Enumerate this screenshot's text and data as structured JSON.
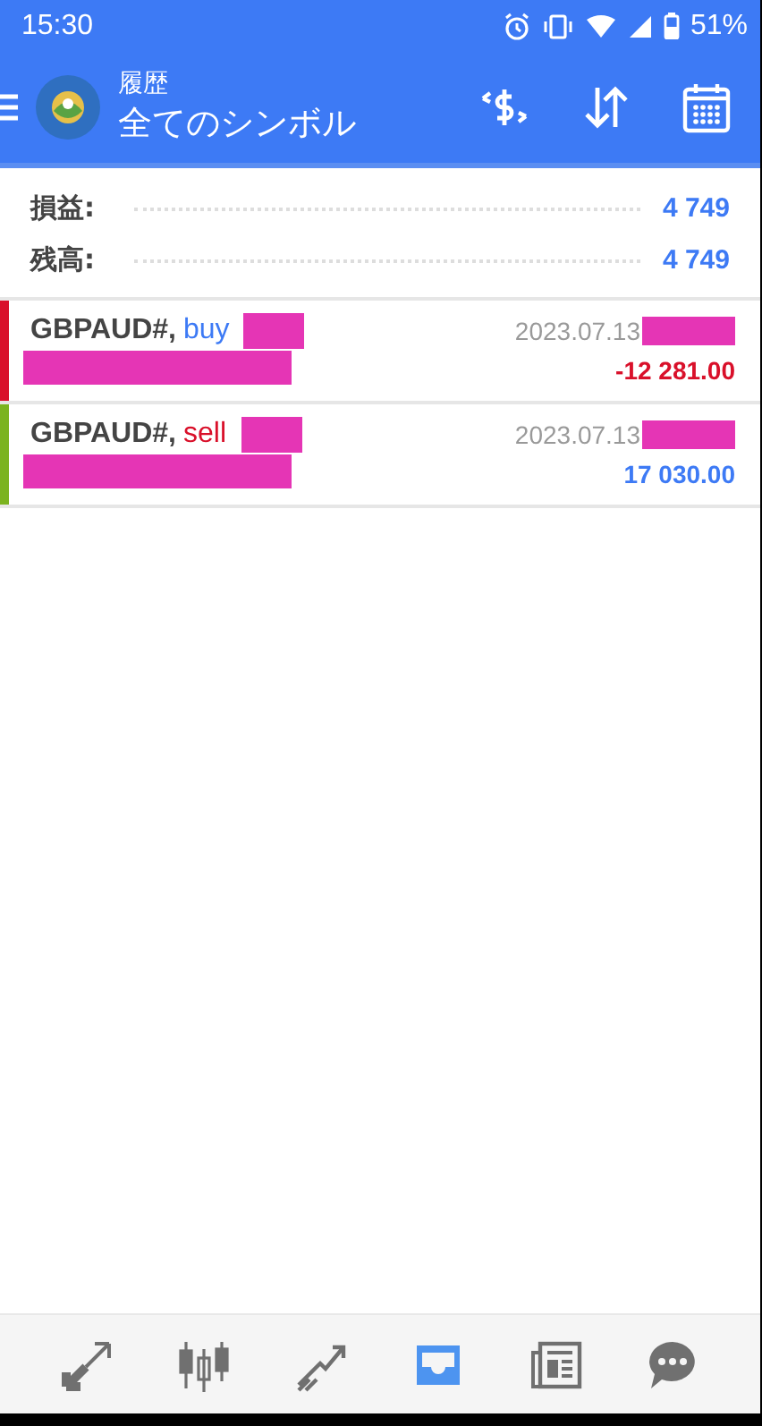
{
  "status_bar": {
    "time": "15:30",
    "battery": "51%"
  },
  "header": {
    "subtitle": "履歴",
    "title": "全てのシンボル"
  },
  "summary": [
    {
      "label": "損益:",
      "value": "4 749"
    },
    {
      "label": "残高:",
      "value": "4 749"
    }
  ],
  "deals": [
    {
      "symbol": "GBPAUD#,",
      "side": "buy",
      "date": "2023.07.13",
      "profit": "-12 281.00",
      "color": "#d9102a"
    },
    {
      "symbol": "GBPAUD#,",
      "side": "sell",
      "date": "2023.07.13",
      "profit": "17 030.00",
      "color": "#7bb31f"
    }
  ],
  "nav": [
    {
      "selected": false
    },
    {
      "selected": false
    },
    {
      "selected": false
    },
    {
      "selected": true
    },
    {
      "selected": false
    },
    {
      "selected": false
    }
  ]
}
